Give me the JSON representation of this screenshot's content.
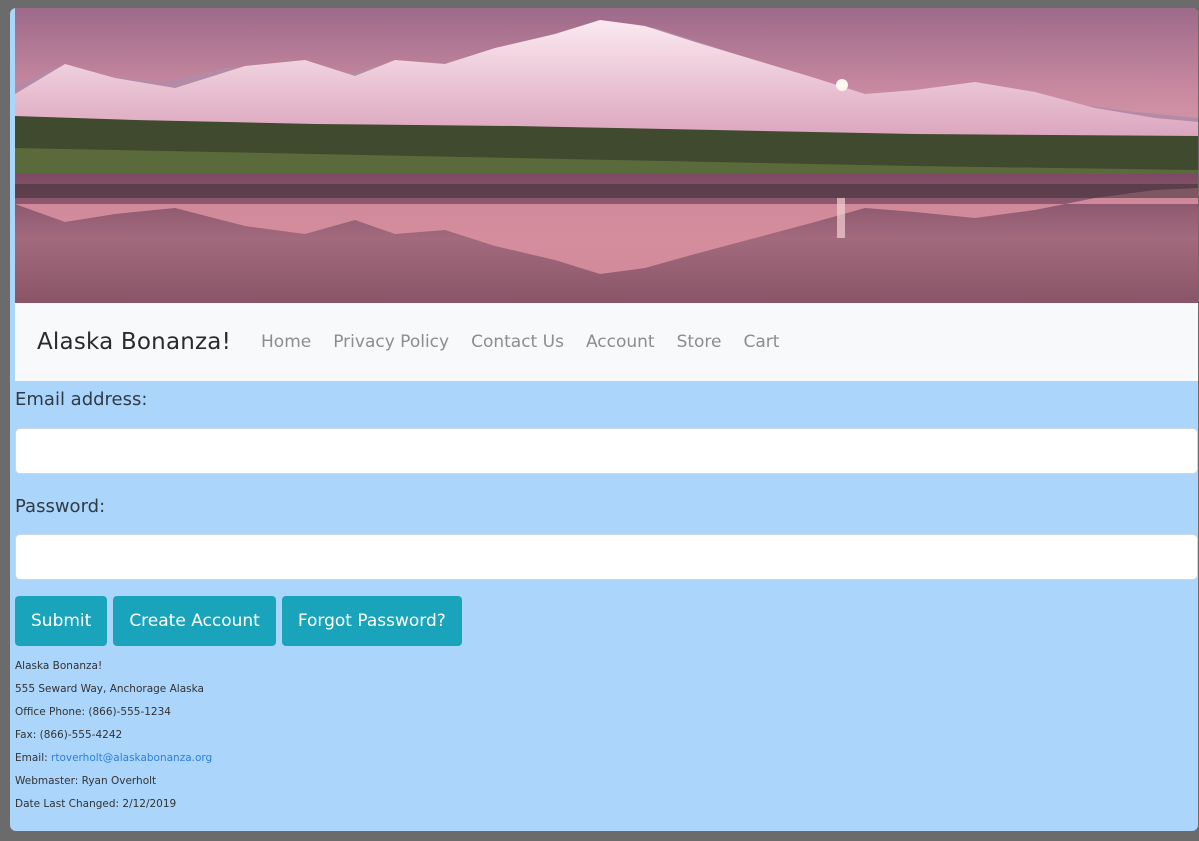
{
  "nav": {
    "brand": "Alaska Bonanza!",
    "links": [
      "Home",
      "Privacy Policy",
      "Contact Us",
      "Account",
      "Store",
      "Cart"
    ]
  },
  "form": {
    "email_label": "Email address:",
    "email_value": "",
    "password_label": "Password:",
    "password_value": "",
    "buttons": {
      "submit": "Submit",
      "create_account": "Create Account",
      "forgot_password": "Forgot Password?"
    }
  },
  "footer": {
    "name": "Alaska Bonanza!",
    "address": "555 Seward Way, Anchorage Alaska",
    "phone": "Office Phone: (866)-555-1234",
    "fax": "Fax: (866)-555-4242",
    "email_label": "Email: ",
    "email_link": "rtoverholt@alaskabonanza.org",
    "webmaster": "Webmaster: Ryan Overholt",
    "last_changed": "Date Last Changed: 2/12/2019"
  },
  "colors": {
    "page_bg": "#abd5fb",
    "navbar_bg": "#f8f9fa",
    "button_bg": "#1aa4bc",
    "link": "#2e7fd9"
  }
}
